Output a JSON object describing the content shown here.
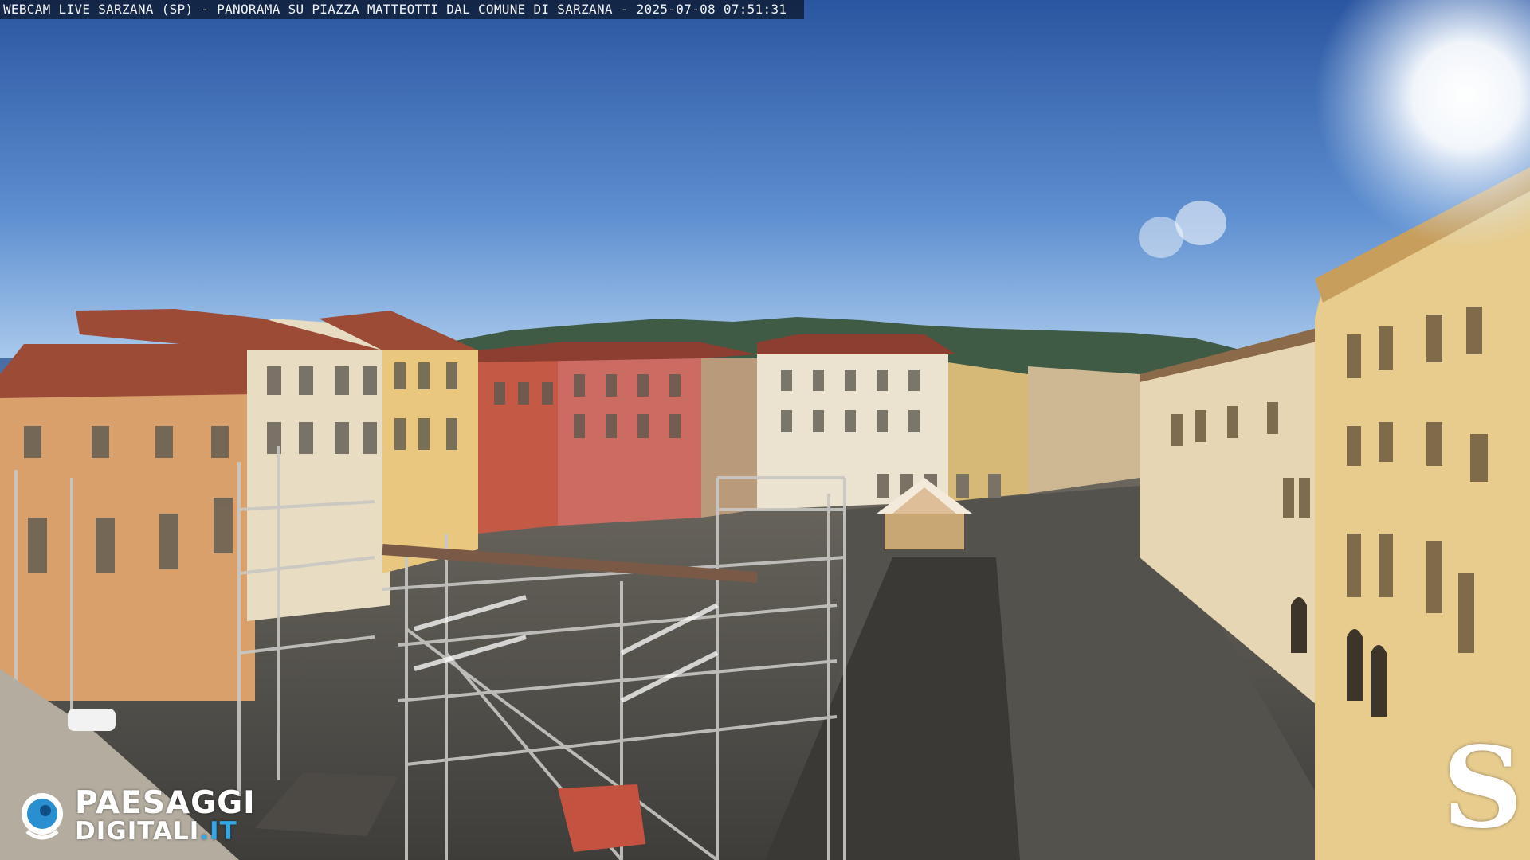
{
  "overlay": {
    "caption": "WEBCAM LIVE SARZANA (SP) - PANORAMA SU PIAZZA MATTEOTTI DAL COMUNE DI SARZANA - 2025-07-08  07:51:31"
  },
  "branding": {
    "left_logo_top": "PAESAGGI",
    "left_logo_bottom": "DIGITALI",
    "left_logo_tld": ".IT",
    "left_logo_icon": "eye-icon",
    "right_logo_letter": "S"
  },
  "colors": {
    "sky_top": "#2d57a0",
    "sky_horizon": "#9bbfe6",
    "accent_blue": "#33a6e8"
  }
}
